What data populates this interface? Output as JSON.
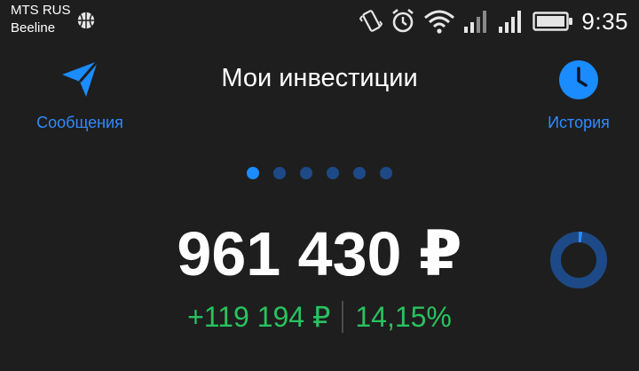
{
  "status_bar": {
    "carrier_1": "MTS RUS",
    "carrier_2": "Beeline",
    "time": "9:35",
    "icons": [
      "basketball-icon",
      "vibrate-icon",
      "alarm-icon",
      "wifi-icon",
      "signal-icon",
      "signal-icon",
      "battery-icon"
    ]
  },
  "header": {
    "title": "Мои инвестиции",
    "messages_label": "Сообщения",
    "history_label": "История"
  },
  "pager": {
    "count": 6,
    "active_index": 0
  },
  "portfolio": {
    "balance": "961 430 ₽",
    "change_amount": "+119 194 ₽",
    "change_percent": "14,15%"
  },
  "colors": {
    "background": "#1e1e1e",
    "accent_blue": "#1a8cff",
    "positive_green": "#29c25f",
    "inactive_dot": "#1d4a86"
  }
}
